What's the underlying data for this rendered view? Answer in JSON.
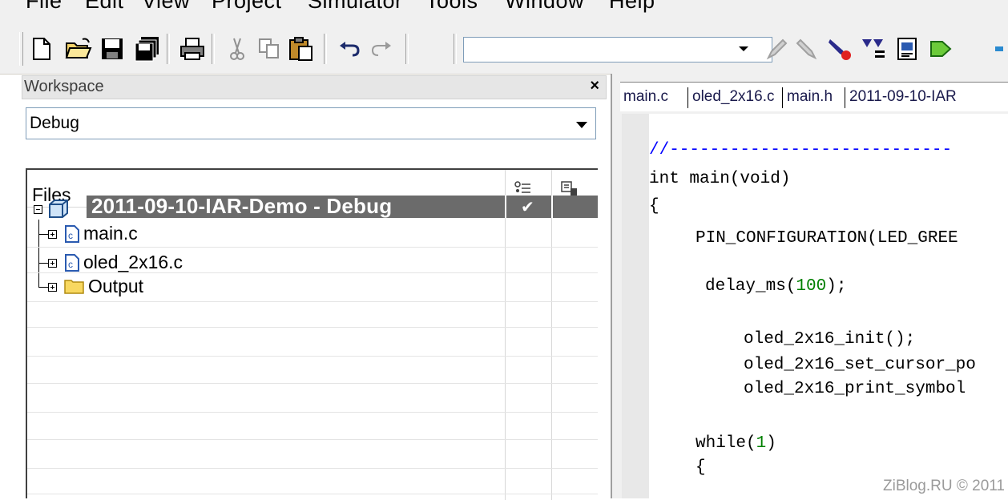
{
  "menu": {
    "items": [
      {
        "label": "File"
      },
      {
        "label": "Edit"
      },
      {
        "label": "View"
      },
      {
        "label": "Project"
      },
      {
        "label": "Simulator"
      },
      {
        "label": "Tools"
      },
      {
        "label": "Window"
      },
      {
        "label": "Help"
      }
    ]
  },
  "toolbar": {
    "combo_value": ""
  },
  "workspace": {
    "title": "Workspace",
    "close_label": "×",
    "config": "Debug",
    "files_header": "Files",
    "project": {
      "name": "2011-09-10-IAR-Demo - Debug",
      "checked_mark": "✔"
    },
    "items": [
      {
        "name": "main.c",
        "type": "c-file"
      },
      {
        "name": "oled_2x16.c",
        "type": "c-file"
      },
      {
        "name": "Output",
        "type": "folder"
      }
    ]
  },
  "editor": {
    "tabs": [
      {
        "label": "main.c"
      },
      {
        "label": "oled_2x16.c"
      },
      {
        "label": "main.h"
      },
      {
        "label": "2011-09-10-IAR"
      }
    ],
    "code": {
      "l1": "//----------------------------",
      "l2": "int main(void)",
      "l3": "{",
      "l4": "PIN_CONFIGURATION(LED_GREE",
      "l5a": "delay_ms(",
      "l5b": "100",
      "l5c": ");",
      "l6": "oled_2x16_init();",
      "l7": "oled_2x16_set_cursor_po",
      "l8": "oled_2x16_print_symbol",
      "l9a": "while(",
      "l9b": "1",
      "l9c": ")",
      "l10": "{"
    },
    "watermark": "ZiBlog.RU © 2011"
  }
}
